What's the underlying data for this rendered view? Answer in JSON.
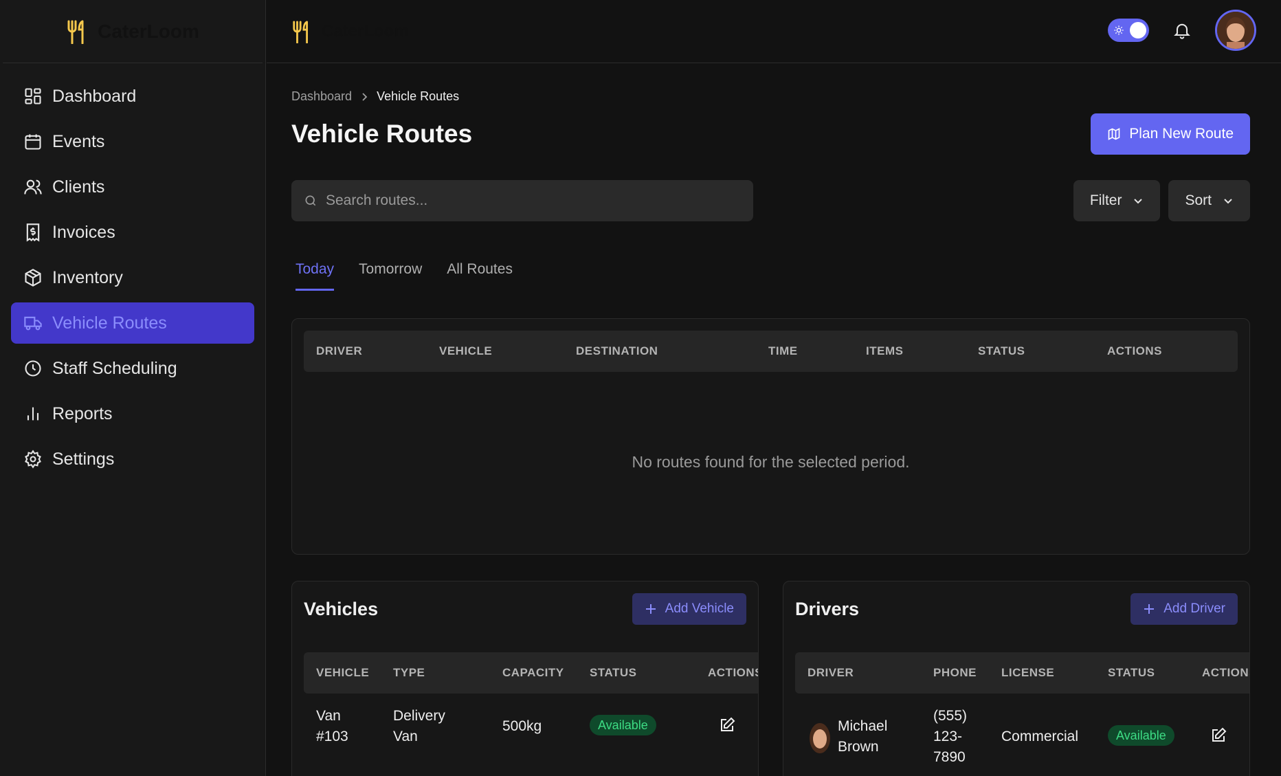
{
  "brand": {
    "name": "CaterLoom",
    "accent": "#6366f1",
    "logo_color": "#f5c84c"
  },
  "sidebar": {
    "items": [
      {
        "label": "Dashboard",
        "icon": "dashboard-icon"
      },
      {
        "label": "Events",
        "icon": "calendar-icon"
      },
      {
        "label": "Clients",
        "icon": "users-icon"
      },
      {
        "label": "Invoices",
        "icon": "invoice-icon"
      },
      {
        "label": "Inventory",
        "icon": "package-icon"
      },
      {
        "label": "Vehicle Routes",
        "icon": "truck-icon",
        "active": true
      },
      {
        "label": "Staff Scheduling",
        "icon": "clock-icon"
      },
      {
        "label": "Reports",
        "icon": "bar-chart-icon"
      },
      {
        "label": "Settings",
        "icon": "gear-icon"
      }
    ]
  },
  "breadcrumb": {
    "root": "Dashboard",
    "current": "Vehicle Routes"
  },
  "page": {
    "title": "Vehicle Routes",
    "plan_button": "Plan New Route",
    "search_placeholder": "Search routes...",
    "filter_label": "Filter",
    "sort_label": "Sort"
  },
  "tabs": [
    {
      "label": "Today",
      "active": true
    },
    {
      "label": "Tomorrow"
    },
    {
      "label": "All Routes"
    }
  ],
  "routes_table": {
    "columns": [
      "DRIVER",
      "VEHICLE",
      "DESTINATION",
      "TIME",
      "ITEMS",
      "STATUS",
      "ACTIONS"
    ],
    "empty_message": "No routes found for the selected period."
  },
  "vehicles": {
    "title": "Vehicles",
    "add_label": "Add Vehicle",
    "columns": [
      "VEHICLE",
      "TYPE",
      "CAPACITY",
      "STATUS",
      "ACTIONS"
    ],
    "rows": [
      {
        "vehicle_l1": "Van",
        "vehicle_l2": "#103",
        "type_l1": "Delivery",
        "type_l2": "Van",
        "capacity": "500kg",
        "status": "Available"
      }
    ]
  },
  "drivers": {
    "title": "Drivers",
    "add_label": "Add Driver",
    "columns": [
      "DRIVER",
      "PHONE",
      "LICENSE",
      "STATUS",
      "ACTIONS"
    ],
    "rows": [
      {
        "name_l1": "Michael",
        "name_l2": "Brown",
        "phone_l1": "(555)",
        "phone_l2": "123-",
        "phone_l3": "7890",
        "license": "Commercial",
        "status": "Available"
      }
    ]
  }
}
